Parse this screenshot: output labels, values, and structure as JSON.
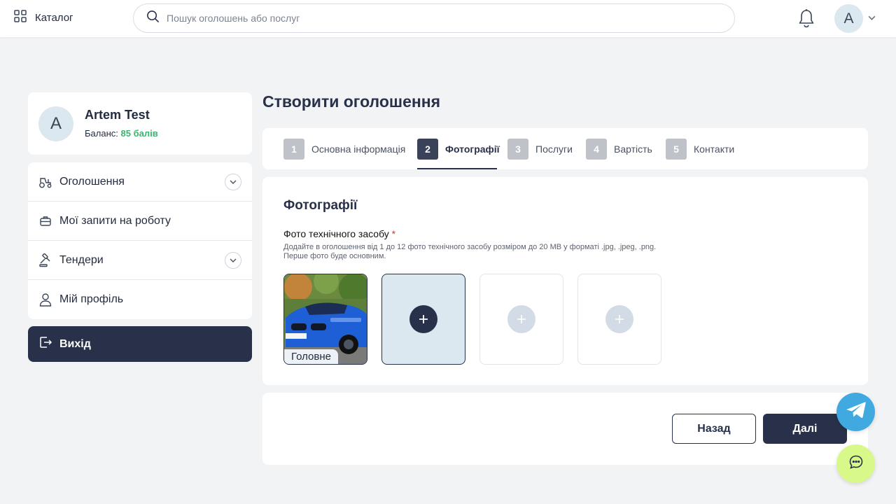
{
  "header": {
    "catalog_label": "Каталог",
    "search_placeholder": "Пошук оголошень або послуг",
    "avatar_letter": "A"
  },
  "profile": {
    "avatar_letter": "A",
    "name": "Artem Test",
    "balance_label": "Баланс:",
    "balance_points": "85 балів"
  },
  "sidebar": {
    "items": [
      {
        "label": "Оголошення",
        "icon": "tractor-icon",
        "expandable": true
      },
      {
        "label": "Мої запити на роботу",
        "icon": "briefcase-icon",
        "expandable": false
      },
      {
        "label": "Тендери",
        "icon": "gavel-icon",
        "expandable": true
      },
      {
        "label": "Мій профіль",
        "icon": "user-icon",
        "expandable": false
      }
    ],
    "logout_label": "Вихід"
  },
  "main": {
    "title": "Створити оголошення",
    "steps": [
      {
        "num": "1",
        "label": "Основна інформація",
        "active": false
      },
      {
        "num": "2",
        "label": "Фотографії",
        "active": true
      },
      {
        "num": "3",
        "label": "Послуги",
        "active": false
      },
      {
        "num": "4",
        "label": "Вартість",
        "active": false
      },
      {
        "num": "5",
        "label": "Контакти",
        "active": false
      }
    ],
    "section_title": "Фотографії",
    "field_label": "Фото технічного засобу",
    "required_mark": "*",
    "field_hint": "Додайте в оголошення від 1 до 12 фото технічного засобу розміром до 20 MB у форматі .jpg, .jpeg, .png. Перше фото буде основним.",
    "main_photo_tag": "Головне",
    "back_label": "Назад",
    "next_label": "Далі"
  },
  "colors": {
    "accent_dark": "#29304a",
    "balance_green": "#3cb371",
    "telegram_blue": "#3fa9e0",
    "chat_lime": "#d8f98a"
  }
}
